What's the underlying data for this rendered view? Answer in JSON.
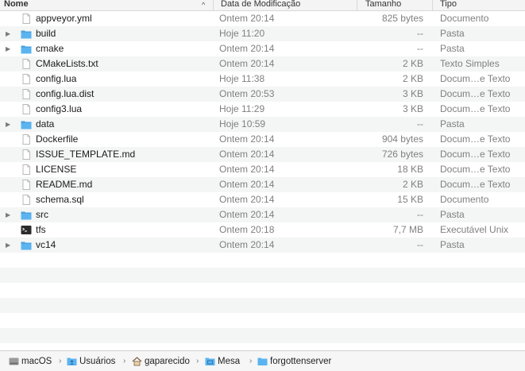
{
  "header": {
    "name_label": "Nome",
    "date_label": "Data de Modificação",
    "size_label": "Tamanho",
    "kind_label": "Tipo",
    "sort_arrow": "^"
  },
  "files": [
    {
      "name": "appveyor.yml",
      "date": "Ontem 20:14",
      "size": "825 bytes",
      "kind": "Documento",
      "icon": "document-icon",
      "folder": false
    },
    {
      "name": "build",
      "date": "Hoje 11:20",
      "size": "--",
      "kind": "Pasta",
      "icon": "folder-icon",
      "folder": true
    },
    {
      "name": "cmake",
      "date": "Ontem 20:14",
      "size": "--",
      "kind": "Pasta",
      "icon": "folder-icon",
      "folder": true
    },
    {
      "name": "CMakeLists.txt",
      "date": "Ontem 20:14",
      "size": "2 KB",
      "kind": "Texto Simples",
      "icon": "document-icon",
      "folder": false
    },
    {
      "name": "config.lua",
      "date": "Hoje 11:38",
      "size": "2 KB",
      "kind": "Docum…e Texto",
      "icon": "document-icon",
      "folder": false
    },
    {
      "name": "config.lua.dist",
      "date": "Ontem 20:53",
      "size": "3 KB",
      "kind": "Docum…e Texto",
      "icon": "document-icon",
      "folder": false
    },
    {
      "name": "config3.lua",
      "date": "Hoje 11:29",
      "size": "3 KB",
      "kind": "Docum…e Texto",
      "icon": "document-icon",
      "folder": false
    },
    {
      "name": "data",
      "date": "Hoje 10:59",
      "size": "--",
      "kind": "Pasta",
      "icon": "folder-icon",
      "folder": true
    },
    {
      "name": "Dockerfile",
      "date": "Ontem 20:14",
      "size": "904 bytes",
      "kind": "Docum…e Texto",
      "icon": "document-icon",
      "folder": false
    },
    {
      "name": "ISSUE_TEMPLATE.md",
      "date": "Ontem 20:14",
      "size": "726 bytes",
      "kind": "Docum…e Texto",
      "icon": "document-icon",
      "folder": false
    },
    {
      "name": "LICENSE",
      "date": "Ontem 20:14",
      "size": "18 KB",
      "kind": "Docum…e Texto",
      "icon": "document-icon",
      "folder": false
    },
    {
      "name": "README.md",
      "date": "Ontem 20:14",
      "size": "2 KB",
      "kind": "Docum…e Texto",
      "icon": "document-icon",
      "folder": false
    },
    {
      "name": "schema.sql",
      "date": "Ontem 20:14",
      "size": "15 KB",
      "kind": "Documento",
      "icon": "document-icon",
      "folder": false
    },
    {
      "name": "src",
      "date": "Ontem 20:14",
      "size": "--",
      "kind": "Pasta",
      "icon": "folder-icon",
      "folder": true
    },
    {
      "name": "tfs",
      "date": "Ontem 20:18",
      "size": "7,7 MB",
      "kind": "Executável Unix",
      "icon": "terminal-executable-icon",
      "folder": false
    },
    {
      "name": "vc14",
      "date": "Ontem 20:14",
      "size": "--",
      "kind": "Pasta",
      "icon": "folder-icon",
      "folder": true
    }
  ],
  "empty_rows": 6,
  "pathbar": {
    "separator": "›",
    "items": [
      {
        "label": "macOS",
        "icon": "hard-drive-icon"
      },
      {
        "label": "Usuários",
        "icon": "users-folder-icon"
      },
      {
        "label": "gaparecido",
        "icon": "home-icon"
      },
      {
        "label": "Mesa",
        "icon": "desktop-folder-icon"
      },
      {
        "label": "forgottenserver",
        "icon": "folder-icon"
      }
    ]
  },
  "colors": {
    "folder": "#5ab4f0",
    "folder_tab": "#4aa3e0",
    "row_alt": "#f4f5f5",
    "secondary_text": "#808080"
  }
}
